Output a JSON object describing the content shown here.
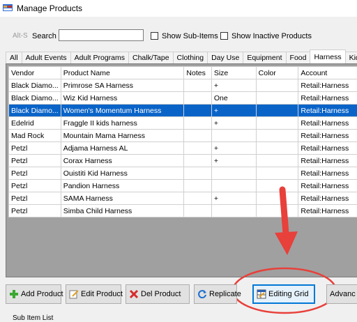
{
  "window": {
    "title": "Manage Products"
  },
  "search": {
    "alt_hint": "Alt-S",
    "label": "Search",
    "value": "",
    "show_sub_items": "Show Sub-Items",
    "show_inactive": "Show Inactive Products"
  },
  "tabs": [
    "All",
    "Adult Events",
    "Adult Programs",
    "Chalk/Tape",
    "Clothing",
    "Day Use",
    "Equipment",
    "Food",
    "Harness",
    "Kids"
  ],
  "active_tab": "Harness",
  "grid": {
    "columns": [
      "Vendor",
      "Product Name",
      "Notes",
      "Size",
      "Color",
      "Account"
    ],
    "rows": [
      [
        "Black Diamo...",
        "Primrose SA Harness",
        "",
        "+",
        "",
        "Retail:Harness"
      ],
      [
        "Black Diamo...",
        "Wiz Kid Harness",
        "",
        "One",
        "",
        "Retail:Harness"
      ],
      [
        "Black Diamo...",
        "Women's Momentum Harness",
        "",
        "+",
        "",
        "Retail:Harness"
      ],
      [
        "Edelrid",
        "Fraggle II kids harness",
        "",
        "+",
        "",
        "Retail:Harness"
      ],
      [
        "Mad Rock",
        "Mountain Mama Harness",
        "",
        "",
        "",
        "Retail:Harness"
      ],
      [
        "Petzl",
        "Adjama Harness AL",
        "",
        "+",
        "",
        "Retail:Harness"
      ],
      [
        "Petzl",
        "Corax Harness",
        "",
        "+",
        "",
        "Retail:Harness"
      ],
      [
        "Petzl",
        "Ouistiti Kid Harness",
        "",
        "",
        "",
        "Retail:Harness"
      ],
      [
        "Petzl",
        "Pandion Harness",
        "",
        "",
        "",
        "Retail:Harness"
      ],
      [
        "Petzl",
        "SAMA Harness",
        "",
        "+",
        "",
        "Retail:Harness"
      ],
      [
        "Petzl",
        "Simba Child Harness",
        "",
        "",
        "",
        "Retail:Harness"
      ]
    ],
    "selected_row": 2
  },
  "buttons": {
    "add": "Add Product",
    "edit": "Edit Product",
    "del": "Del Product",
    "replicate": "Replicate",
    "editing_grid": "Editing Grid",
    "advanced": "Advanc"
  },
  "bottom": {
    "label": "Sub Item List"
  },
  "colors": {
    "selection": "#0a64c8",
    "annotation": "#e8403a"
  },
  "icons": [
    "app-icon",
    "add-icon",
    "edit-icon",
    "delete-icon",
    "replicate-icon",
    "grid-icon"
  ]
}
